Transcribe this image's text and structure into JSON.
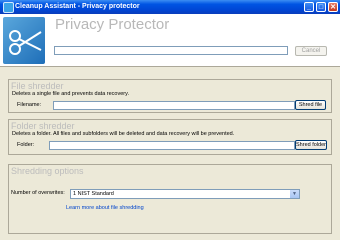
{
  "window": {
    "title": "Cleanup Assistant - Privacy protector",
    "controls": {
      "minimize": "_",
      "maximize": "□",
      "close": "✕"
    }
  },
  "header": {
    "title": "Privacy Protector",
    "path_value": "",
    "cancel_label": "Cancel"
  },
  "file_shredder": {
    "title": "File shredder",
    "description": "Deletes a single file and prevents data recovery.",
    "field_label": "Filename:",
    "field_value": "",
    "button_label": "Shred file"
  },
  "folder_shredder": {
    "title": "Folder shredder",
    "description": "Deletes a folder. All files and subfolders will be deleted and data recovery will be prevented.",
    "field_label": "Folder:",
    "field_value": "",
    "button_label": "Shred folder"
  },
  "options": {
    "title": "Shredding options",
    "overwrites_label": "Number of overwrites:",
    "overwrites_value": "1 NIST Standard",
    "learn_more": "Learn more about file shredding"
  },
  "icons": {
    "app": "broom-icon",
    "logo": "scissors-icon"
  }
}
